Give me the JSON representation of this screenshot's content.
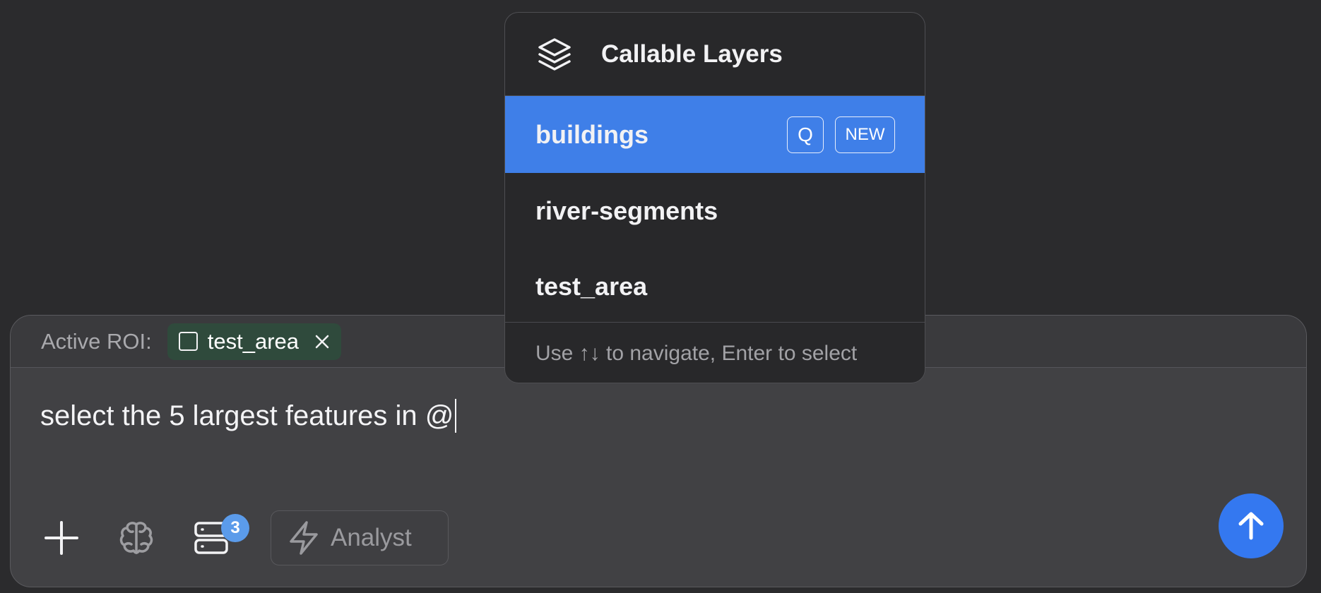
{
  "dropdown": {
    "title": "Callable Layers",
    "header_icon": "layers-icon",
    "items": [
      {
        "label": "buildings",
        "selected": true,
        "shortcut": "Q",
        "badge": "NEW"
      },
      {
        "label": "river-segments",
        "selected": false
      },
      {
        "label": "test_area",
        "selected": false
      }
    ],
    "hint": "Use ↑↓ to navigate, Enter to select"
  },
  "composer": {
    "roi_label": "Active ROI:",
    "roi_chip": "test_area",
    "prompt_text": "select the 5 largest features in @",
    "tools": {
      "add_icon": "plus-icon",
      "brain_icon": "brain-icon",
      "data_icon": "server-icon",
      "data_badge": "3",
      "mode_icon": "lightning-icon",
      "mode_label": "Analyst"
    },
    "send_icon": "arrow-up-icon"
  },
  "colors": {
    "background": "#2b2b2d",
    "composer": "#414144",
    "accent": "#3478f0",
    "selected_item": "#3f7fe8",
    "roi_chip": "#2f4a3c",
    "badge": "#5b9bea"
  }
}
